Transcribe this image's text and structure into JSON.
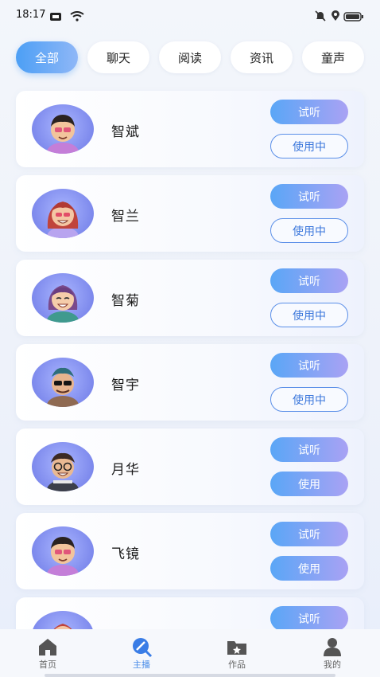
{
  "status_bar": {
    "time": "18:17"
  },
  "tabs": [
    {
      "label": "全部",
      "active": true
    },
    {
      "label": "聊天",
      "active": false
    },
    {
      "label": "阅读",
      "active": false
    },
    {
      "label": "资讯",
      "active": false
    },
    {
      "label": "童声",
      "active": false
    }
  ],
  "voices": [
    {
      "name": "智斌",
      "listen_label": "试听",
      "use_label": "使用中",
      "state": "in-use"
    },
    {
      "name": "智兰",
      "listen_label": "试听",
      "use_label": "使用中",
      "state": "in-use"
    },
    {
      "name": "智菊",
      "listen_label": "试听",
      "use_label": "使用中",
      "state": "in-use"
    },
    {
      "name": "智宇",
      "listen_label": "试听",
      "use_label": "使用中",
      "state": "in-use"
    },
    {
      "name": "月华",
      "listen_label": "试听",
      "use_label": "使用",
      "state": "available"
    },
    {
      "name": "飞镜",
      "listen_label": "试听",
      "use_label": "使用",
      "state": "available"
    },
    {
      "name": "",
      "listen_label": "试听",
      "use_label": "",
      "state": "partial"
    }
  ],
  "bottom_nav": [
    {
      "label": "首页",
      "icon": "home-icon",
      "active": false
    },
    {
      "label": "主播",
      "icon": "anchor-icon",
      "active": true
    },
    {
      "label": "作品",
      "icon": "works-folder-icon",
      "active": false
    },
    {
      "label": "我的",
      "icon": "profile-icon",
      "active": false
    }
  ],
  "colors": {
    "accent_blue": "#4c9ff5",
    "accent_purple": "#a9a2f4",
    "in_use_border": "#5b8fe8"
  }
}
